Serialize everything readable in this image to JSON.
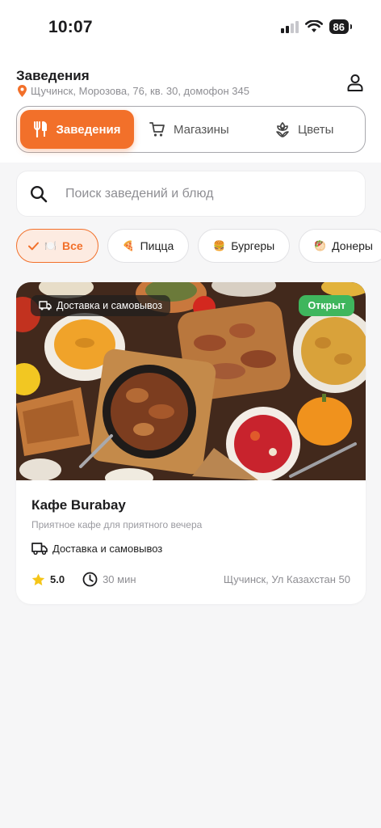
{
  "status_bar": {
    "time": "10:07",
    "battery": "86"
  },
  "header": {
    "title": "Заведения",
    "address": "Щучинск, Морозова, 76, кв. 30, домофон 345"
  },
  "segments": [
    {
      "label": "Заведения",
      "icon": "cutlery-icon",
      "active": true
    },
    {
      "label": "Магазины",
      "icon": "cart-icon",
      "active": false
    },
    {
      "label": "Цветы",
      "icon": "flower-icon",
      "active": false
    }
  ],
  "search": {
    "placeholder": "Поиск заведений и блюд",
    "value": ""
  },
  "filters": [
    {
      "emoji": "🍽️",
      "label": "Все",
      "active": true
    },
    {
      "emoji": "🍕",
      "label": "Пицца",
      "active": false
    },
    {
      "emoji": "🍔",
      "label": "Бургеры",
      "active": false
    },
    {
      "emoji": "🥙",
      "label": "Донеры",
      "active": false
    }
  ],
  "restaurant": {
    "name": "Кафе Burabay",
    "description": "Приятное кафе для приятного вечера",
    "delivery_badge": "Доставка и самовывоз",
    "status": "Открыт",
    "delivery": "Доставка и самовывоз",
    "rating": "5.0",
    "time": "30 мин",
    "address": "Щучинск, Ул Казахстан 50"
  },
  "colors": {
    "accent": "#f2702a",
    "open": "#3fb65d",
    "star": "#f5c518"
  }
}
